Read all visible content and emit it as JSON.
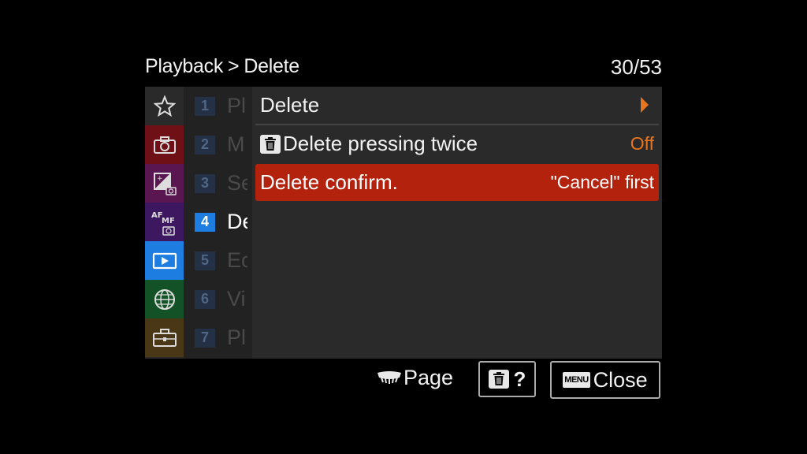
{
  "header": {
    "breadcrumb_parent": "Playback",
    "breadcrumb_sep": ">",
    "breadcrumb_current": "Delete",
    "page_counter": "30/53"
  },
  "categories": [
    {
      "name": "my-menu-star-icon",
      "color": "#2a2a2a",
      "active": false
    },
    {
      "name": "shooting-camera-icon",
      "color": "#6e1016",
      "active": false
    },
    {
      "name": "exposure-color-icon",
      "color": "#5a1650",
      "active": false
    },
    {
      "name": "af-mf-icon",
      "color": "#3d1760",
      "active": false
    },
    {
      "name": "playback-icon",
      "color": "#1d7de0",
      "active": true
    },
    {
      "name": "network-globe-icon",
      "color": "#125226",
      "active": false
    },
    {
      "name": "setup-toolbox-icon",
      "color": "#4a3716",
      "active": false
    }
  ],
  "pages": [
    {
      "num": "1",
      "name": "Pl",
      "active": false
    },
    {
      "num": "2",
      "name": "M",
      "active": false
    },
    {
      "num": "3",
      "name": "Se",
      "active": false
    },
    {
      "num": "4",
      "name": "De",
      "active": true
    },
    {
      "num": "5",
      "name": "Ec",
      "active": false
    },
    {
      "num": "6",
      "name": "Vi",
      "active": false
    },
    {
      "num": "7",
      "name": "Pl",
      "active": false
    }
  ],
  "items": [
    {
      "label": "Delete",
      "value": "",
      "has_arrow": true,
      "selected": false
    },
    {
      "label": "Delete pressing twice",
      "value": "Off",
      "has_trash_icon": true,
      "selected": false
    },
    {
      "label": "Delete confirm.",
      "value": "\"Cancel\" first",
      "selected": true
    }
  ],
  "footer": {
    "page_label": "Page",
    "help_label": "?",
    "menu_key": "MENU",
    "close_label": "Close"
  },
  "colors": {
    "selected_row": "#b3220d",
    "value_orange": "#e87620",
    "active_page": "#1d7de0"
  }
}
